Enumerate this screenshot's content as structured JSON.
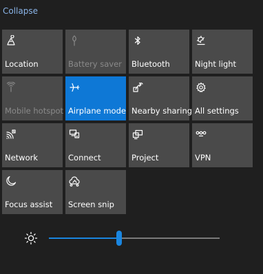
{
  "header": {
    "collapse_label": "Collapse"
  },
  "tiles": [
    {
      "label": "Location",
      "icon": "location-icon",
      "state": "on"
    },
    {
      "label": "Battery saver",
      "icon": "battery-saver-icon",
      "state": "disabled"
    },
    {
      "label": "Bluetooth",
      "icon": "bluetooth-icon",
      "state": "off"
    },
    {
      "label": "Night light",
      "icon": "night-light-icon",
      "state": "off"
    },
    {
      "label": "Mobile hotspot",
      "icon": "mobile-hotspot-icon",
      "state": "disabled"
    },
    {
      "label": "Airplane mode",
      "icon": "airplane-icon",
      "state": "on"
    },
    {
      "label": "Nearby sharing",
      "icon": "nearby-sharing-icon",
      "state": "off"
    },
    {
      "label": "All settings",
      "icon": "gear-icon",
      "state": "off"
    },
    {
      "label": "Network",
      "icon": "network-icon",
      "state": "off"
    },
    {
      "label": "Connect",
      "icon": "connect-icon",
      "state": "off"
    },
    {
      "label": "Project",
      "icon": "project-icon",
      "state": "off"
    },
    {
      "label": "VPN",
      "icon": "vpn-icon",
      "state": "off"
    },
    {
      "label": "Focus assist",
      "icon": "moon-icon",
      "state": "off"
    },
    {
      "label": "Screen snip",
      "icon": "screen-snip-icon",
      "state": "off"
    }
  ],
  "brightness": {
    "icon": "sun-icon",
    "level": 0.41
  },
  "colors": {
    "background": "#1f1f1f",
    "tile": "#4a4a4a",
    "tile_active": "#0e78d6",
    "accent": "#1a86e0",
    "link": "#8ab4e8"
  }
}
